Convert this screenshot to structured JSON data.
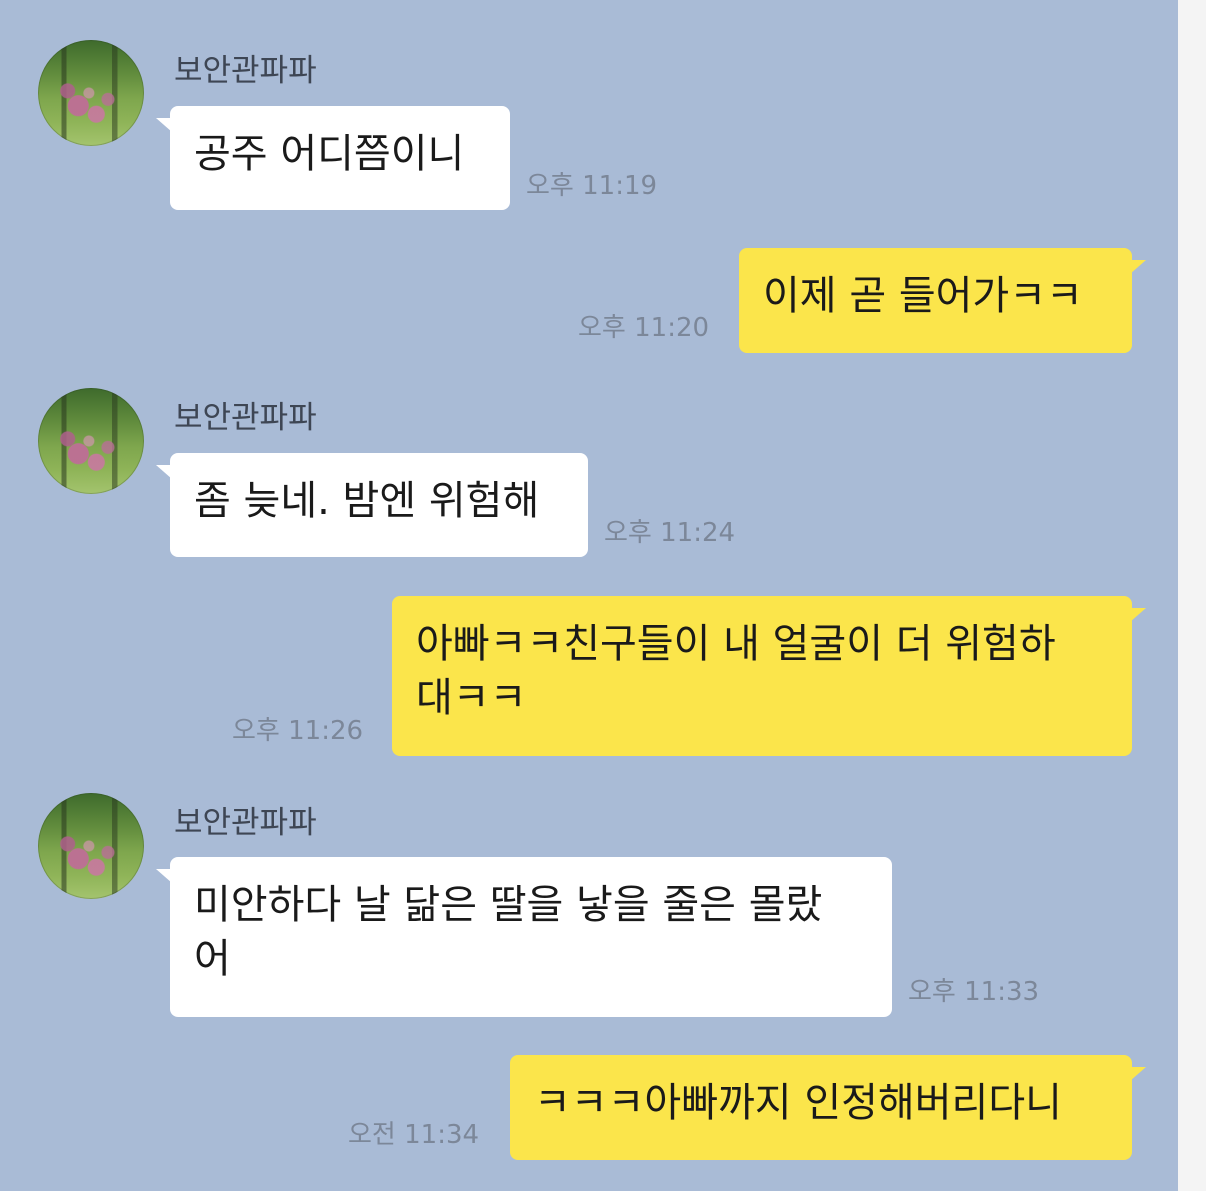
{
  "chat": {
    "messages": [
      {
        "sender": "보안관파파",
        "text": "공주 어디쯤이니",
        "time": "오후 11:19",
        "direction": "incoming"
      },
      {
        "text": "이제 곧 들어가ㅋㅋ",
        "time": "오후 11:20",
        "direction": "outgoing"
      },
      {
        "sender": "보안관파파",
        "text": "좀 늦네. 밤엔 위험해",
        "time": "오후 11:24",
        "direction": "incoming"
      },
      {
        "text_line1": "아빠ㅋㅋ친구들이 내 얼굴이 더 위험하",
        "text_line2": "대ㅋㅋ",
        "time": "오후 11:26",
        "direction": "outgoing"
      },
      {
        "sender": "보안관파파",
        "text_line1": "미안하다 날 닮은 딸을 낳을 줄은 몰랐",
        "text_line2": "어",
        "time": "오후 11:33",
        "direction": "incoming"
      },
      {
        "text": "ㅋㅋㅋ아빠까지 인정해버리다니",
        "time": "오전 11:34",
        "direction": "outgoing"
      }
    ]
  },
  "colors": {
    "chat_background": "#a9bbd6",
    "incoming_bubble": "#ffffff",
    "outgoing_bubble": "#fbe54b",
    "timestamp_text": "#7c8799",
    "sender_text": "#3e4654"
  },
  "icons": {
    "avatar": "profile-photo-flowers"
  }
}
